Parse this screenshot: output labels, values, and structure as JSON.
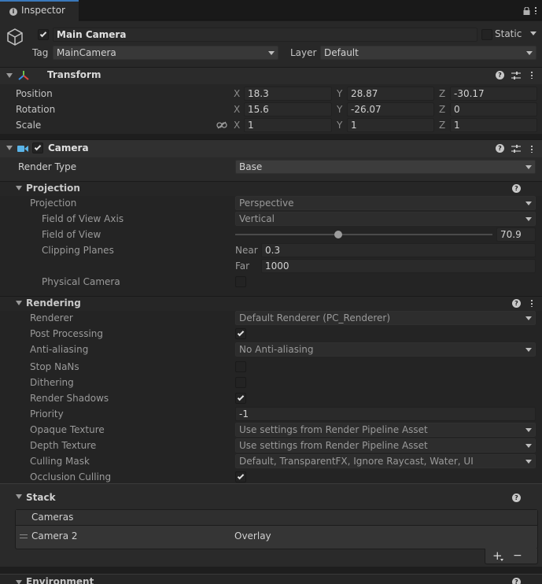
{
  "tab": {
    "title": "Inspector"
  },
  "object": {
    "name": "Main Camera",
    "active": true,
    "static_label": "Static",
    "tag_label": "Tag",
    "tag_value": "MainCamera",
    "layer_label": "Layer",
    "layer_value": "Default"
  },
  "transform": {
    "title": "Transform",
    "position": {
      "label": "Position",
      "x": "18.3",
      "y": "28.87",
      "z": "-30.17"
    },
    "rotation": {
      "label": "Rotation",
      "x": "15.6",
      "y": "-26.07",
      "z": "0"
    },
    "scale": {
      "label": "Scale",
      "x": "1",
      "y": "1",
      "z": "1"
    },
    "axes": {
      "x": "X",
      "y": "Y",
      "z": "Z"
    }
  },
  "camera": {
    "title": "Camera",
    "render_type_label": "Render Type",
    "render_type_value": "Base",
    "projection": {
      "title": "Projection",
      "projection_label": "Projection",
      "projection_value": "Perspective",
      "fov_axis_label": "Field of View Axis",
      "fov_axis_value": "Vertical",
      "fov_label": "Field of View",
      "fov_value": "70.9",
      "clipping_label": "Clipping Planes",
      "near_label": "Near",
      "near_value": "0.3",
      "far_label": "Far",
      "far_value": "1000",
      "physical_label": "Physical Camera"
    },
    "rendering": {
      "title": "Rendering",
      "renderer_label": "Renderer",
      "renderer_value": "Default Renderer (PC_Renderer)",
      "post_label": "Post Processing",
      "aa_label": "Anti-aliasing",
      "aa_value": "No Anti-aliasing",
      "nans_label": "Stop NaNs",
      "dither_label": "Dithering",
      "shadows_label": "Render Shadows",
      "priority_label": "Priority",
      "priority_value": "-1",
      "opaque_label": "Opaque Texture",
      "opaque_value": "Use settings from Render Pipeline Asset",
      "depth_label": "Depth Texture",
      "depth_value": "Use settings from Render Pipeline Asset",
      "culling_label": "Culling Mask",
      "culling_value": "Default, TransparentFX, Ignore Raycast, Water, UI",
      "occlusion_label": "Occlusion Culling"
    },
    "stack": {
      "title": "Stack",
      "list_header": "Cameras",
      "items": [
        {
          "name": "Camera 2",
          "type": "Overlay"
        }
      ],
      "add_label": "+",
      "remove_label": "−"
    },
    "environment": {
      "title": "Environment"
    }
  }
}
